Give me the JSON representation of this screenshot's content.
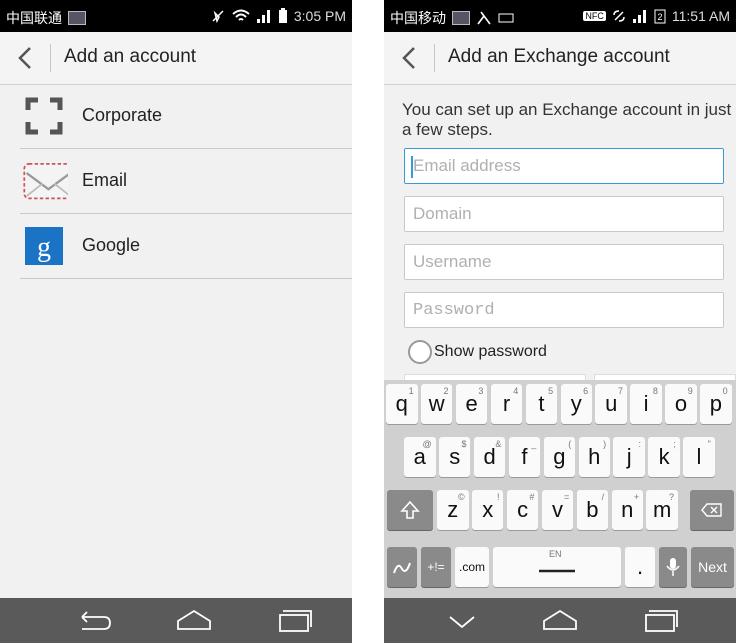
{
  "left": {
    "status": {
      "carrier": "中国联通",
      "time": "3:05 PM"
    },
    "title": "Add an account",
    "items": [
      {
        "label": "Corporate",
        "icon": "corporate-icon"
      },
      {
        "label": "Email",
        "icon": "email-icon"
      },
      {
        "label": "Google",
        "icon": "google-icon"
      }
    ]
  },
  "right": {
    "status": {
      "carrier": "中国移动",
      "time": "11:51 AM",
      "nfc": "NFC"
    },
    "title": "Add an Exchange account",
    "intro": "You can set up an Exchange account in just a few steps.",
    "fields": {
      "email_placeholder": "Email address",
      "domain_placeholder": "Domain",
      "username_placeholder": "Username",
      "password_placeholder": "Password"
    },
    "show_password": "Show password",
    "keyboard": {
      "row1": [
        {
          "k": "q",
          "h": "1"
        },
        {
          "k": "w",
          "h": "2"
        },
        {
          "k": "e",
          "h": "3"
        },
        {
          "k": "r",
          "h": "4"
        },
        {
          "k": "t",
          "h": "5"
        },
        {
          "k": "y",
          "h": "6"
        },
        {
          "k": "u",
          "h": "7"
        },
        {
          "k": "i",
          "h": "8"
        },
        {
          "k": "o",
          "h": "9"
        },
        {
          "k": "p",
          "h": "0"
        }
      ],
      "row2": [
        {
          "k": "a",
          "h": "@"
        },
        {
          "k": "s",
          "h": "$"
        },
        {
          "k": "d",
          "h": "&"
        },
        {
          "k": "f",
          "h": "_"
        },
        {
          "k": "g",
          "h": "("
        },
        {
          "k": "h",
          "h": ")"
        },
        {
          "k": "j",
          "h": ":"
        },
        {
          "k": "k",
          "h": ";"
        },
        {
          "k": "l",
          "h": "\""
        }
      ],
      "row3": [
        {
          "k": "z",
          "h": "©"
        },
        {
          "k": "x",
          "h": "!"
        },
        {
          "k": "c",
          "h": "#"
        },
        {
          "k": "v",
          "h": "="
        },
        {
          "k": "b",
          "h": "/"
        },
        {
          "k": "n",
          "h": "+"
        },
        {
          "k": "m",
          "h": "?"
        }
      ],
      "sym": "+!=",
      "com": ".com",
      "lang": "EN",
      "period": ".",
      "next": "Next"
    }
  }
}
